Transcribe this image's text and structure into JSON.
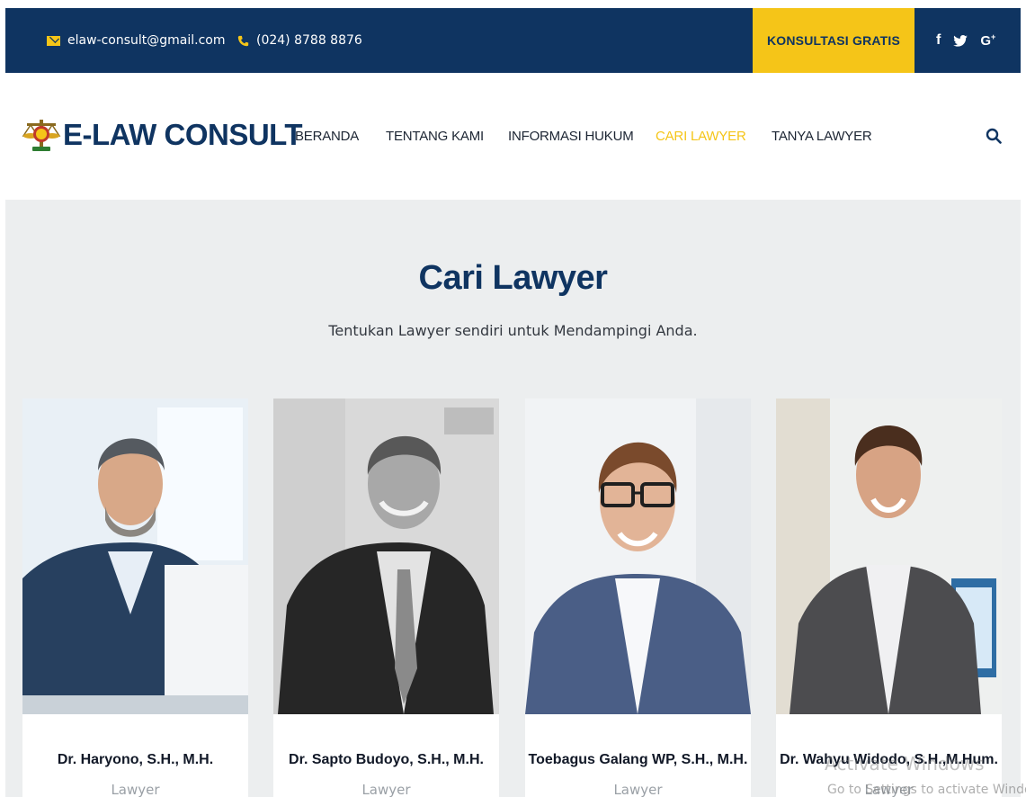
{
  "topbar": {
    "email": "elaw-consult@gmail.com",
    "phone": "(024) 8788 8876",
    "cta_label": "KONSULTASI GRATIS",
    "social": [
      {
        "icon": "facebook-icon",
        "glyph": "f"
      },
      {
        "icon": "twitter-icon",
        "glyph": "🐦"
      },
      {
        "icon": "google-plus-icon",
        "glyph": "G+"
      }
    ],
    "colors": {
      "background": "#0f3461",
      "accent": "#f5c518"
    }
  },
  "header": {
    "logo_text": "E-LAW CONSULT",
    "nav": [
      {
        "label": "BERANDA",
        "active": false
      },
      {
        "label": "TENTANG KAMI",
        "active": false
      },
      {
        "label": "INFORMASI HUKUM",
        "active": false
      },
      {
        "label": "CARI LAWYER",
        "active": true
      },
      {
        "label": "TANYA LAWYER",
        "active": false
      }
    ],
    "search_icon": "search-icon"
  },
  "main": {
    "title": "Cari Lawyer",
    "subtitle": "Tentukan Lawyer sendiri untuk Mendampingi Anda.",
    "lawyers": [
      {
        "name": "Dr. Haryono, S.H., M.H.",
        "role": "Lawyer"
      },
      {
        "name": "Dr. Sapto Budoyo, S.H., M.H.",
        "role": "Lawyer"
      },
      {
        "name": "Toebagus Galang WP, S.H., M.H.",
        "role": "Lawyer"
      },
      {
        "name": "Dr. Wahyu Widodo, S.H.,M.Hum.",
        "role": "Lawyer"
      }
    ]
  },
  "watermark": {
    "line1": "Activate Windows",
    "line2": "Go to Settings to activate Window"
  }
}
